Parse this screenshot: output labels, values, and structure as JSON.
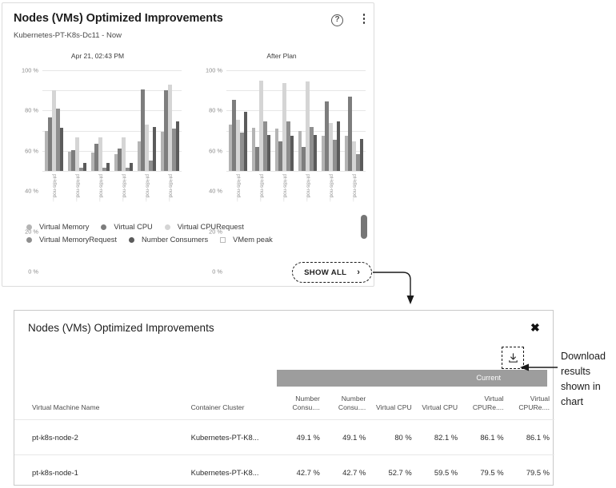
{
  "widget": {
    "title": "Nodes (VMs) Optimized Improvements",
    "subtitle": "Kubernetes-PT-K8s-Dc11 - Now",
    "help_icon": "help-circle-icon",
    "menu_icon": "kebab-menu-icon",
    "show_all_label": "SHOW ALL",
    "show_all_chevron": "›"
  },
  "legend": [
    {
      "label": "Virtual Memory",
      "marker": "dot",
      "color": "#b4b4b4"
    },
    {
      "label": "Virtual CPU",
      "marker": "dot",
      "color": "#7d7d7d"
    },
    {
      "label": "Virtual CPURequest",
      "marker": "dot",
      "color": "#d5d5d5"
    },
    {
      "label": "Virtual MemoryRequest",
      "marker": "dot",
      "color": "#8f8f8f"
    },
    {
      "label": "Number Consumers",
      "marker": "dot",
      "color": "#5b5b5b"
    },
    {
      "label": "VMem peak",
      "marker": "square",
      "color": "#ffffff"
    }
  ],
  "chart_data": [
    {
      "type": "bar",
      "title": "Apr 21, 02:43 PM",
      "xlabel": "",
      "ylabel": "",
      "ylim": [
        0,
        100
      ],
      "yticks": [
        "0 %",
        "20 %",
        "40 %",
        "60 %",
        "80 %",
        "100 %"
      ],
      "grid": true,
      "legend_position": "bottom",
      "categories": [
        "pt-k8s-nod...",
        "pt-k8s-nod...",
        "pt-k8s-nod...",
        "pt-k8s-nod...",
        "pt-k8s-nod...",
        "pt-k8s-nod..."
      ],
      "series": [
        {
          "name": "Virtual Memory",
          "color": "#b4b4b4",
          "values": [
            40,
            19,
            18,
            17,
            29,
            39
          ]
        },
        {
          "name": "Virtual CPU",
          "color": "#7d7d7d",
          "values": [
            53,
            21,
            27,
            22,
            81,
            80
          ]
        },
        {
          "name": "Virtual CPURequest",
          "color": "#d5d5d5",
          "values": [
            80,
            33,
            33,
            33,
            46,
            86
          ]
        },
        {
          "name": "Virtual MemoryRequest",
          "color": "#8f8f8f",
          "values": [
            62,
            3,
            3,
            3,
            10,
            42
          ]
        },
        {
          "name": "Number Consumers",
          "color": "#5b5b5b",
          "values": [
            43,
            8,
            8,
            8,
            44,
            49
          ]
        }
      ]
    },
    {
      "type": "bar",
      "title": "After Plan",
      "xlabel": "",
      "ylabel": "",
      "ylim": [
        0,
        100
      ],
      "yticks": [
        "0 %",
        "20 %",
        "40 %",
        "60 %",
        "80 %",
        "100 %"
      ],
      "grid": true,
      "legend_position": "bottom",
      "categories": [
        "pt-k8s-nod...",
        "pt-k8s-nod...",
        "pt-k8s-nod...",
        "pt-k8s-nod...",
        "pt-k8s-nod...",
        "pt-k8s-nod..."
      ],
      "series": [
        {
          "name": "Virtual Memory",
          "color": "#b4b4b4",
          "values": [
            46,
            43,
            42,
            40,
            35,
            35
          ]
        },
        {
          "name": "Virtual CPU",
          "color": "#7d7d7d",
          "values": [
            71,
            24,
            29,
            24,
            69,
            74
          ]
        },
        {
          "name": "Virtual CPURequest",
          "color": "#d5d5d5",
          "values": [
            51,
            90,
            87,
            89,
            48,
            29
          ]
        },
        {
          "name": "Virtual MemoryRequest",
          "color": "#8f8f8f",
          "values": [
            38,
            49,
            49,
            44,
            31,
            17
          ]
        },
        {
          "name": "Number Consumers",
          "color": "#5b5b5b",
          "values": [
            59,
            36,
            35,
            36,
            49,
            32
          ]
        }
      ]
    }
  ],
  "modal": {
    "title": "Nodes (VMs) Optimized Improvements",
    "close_label": "✖",
    "download_icon": "download-icon",
    "group_header": "Current",
    "columns": [
      "Virtual Machine Name",
      "Container Cluster",
      "Number Consu....",
      "Number Consu....",
      "Virtual CPU",
      "Virtual CPU",
      "Virtual CPURe....",
      "Virtual CPURe...."
    ],
    "rows": [
      [
        "pt-k8s-node-2",
        "Kubernetes-PT-K8...",
        "49.1 %",
        "49.1 %",
        "80 %",
        "82.1 %",
        "86.1 %",
        "86.1 %"
      ],
      [
        "pt-k8s-node-1",
        "Kubernetes-PT-K8...",
        "42.7 %",
        "42.7 %",
        "52.7 %",
        "59.5 %",
        "79.5 %",
        "79.5 %"
      ]
    ]
  },
  "annotations": {
    "download_note": "Download results shown in chart"
  }
}
